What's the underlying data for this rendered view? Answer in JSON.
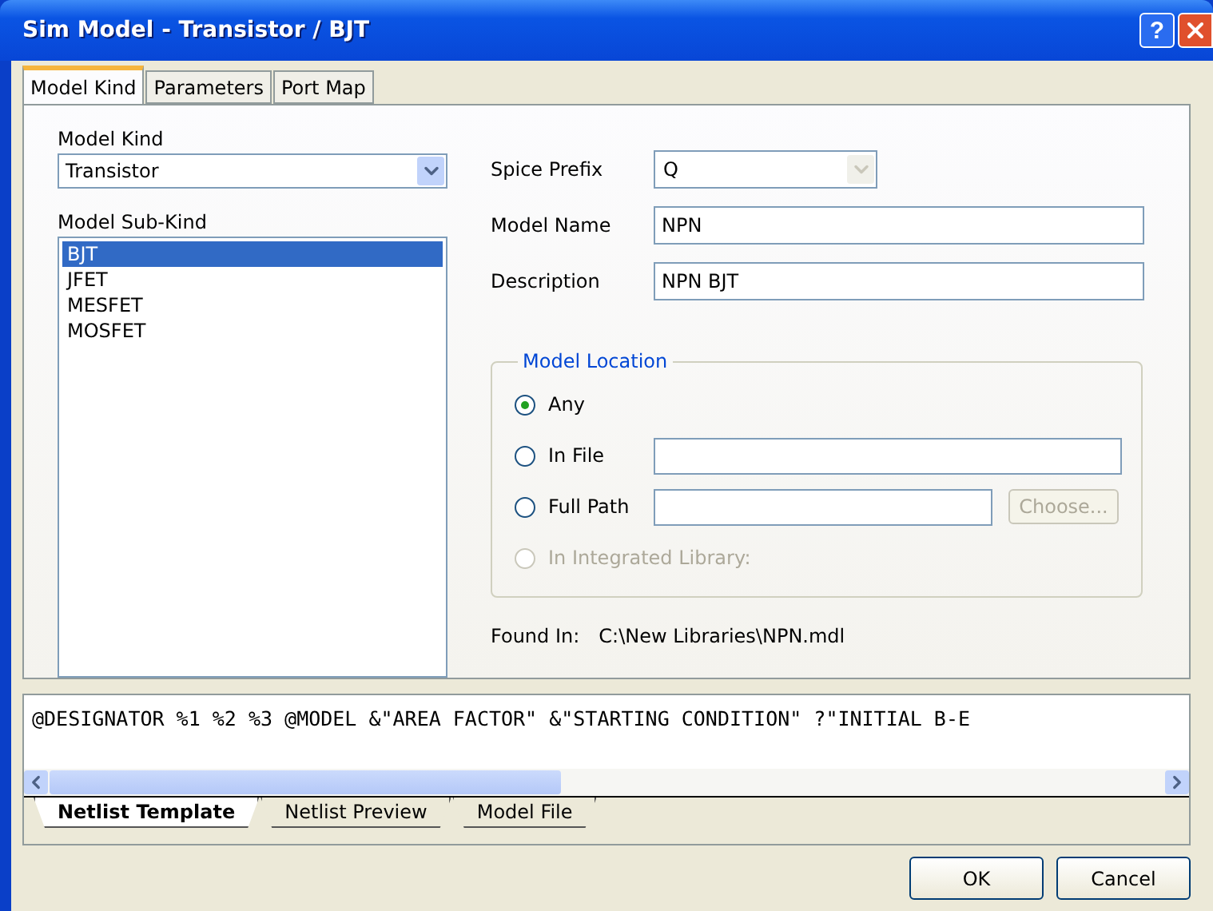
{
  "window": {
    "title": "Sim Model - Transistor / BJT",
    "help": "?"
  },
  "tabs": [
    {
      "label": "Model Kind",
      "selected": true
    },
    {
      "label": "Parameters",
      "selected": false
    },
    {
      "label": "Port Map",
      "selected": false
    }
  ],
  "model_kind": {
    "label": "Model Kind",
    "value": "Transistor"
  },
  "model_sub_kind": {
    "label": "Model Sub-Kind",
    "items": [
      {
        "label": "BJT",
        "selected": true
      },
      {
        "label": "JFET",
        "selected": false
      },
      {
        "label": "MESFET",
        "selected": false
      },
      {
        "label": "MOSFET",
        "selected": false
      }
    ]
  },
  "spice_prefix": {
    "label": "Spice Prefix",
    "value": "Q",
    "disabled": true
  },
  "model_name": {
    "label": "Model Name",
    "value": "NPN"
  },
  "description": {
    "label": "Description",
    "value": "NPN BJT"
  },
  "model_location": {
    "title": "Model Location",
    "options": [
      {
        "kind": "plain",
        "label": "Any",
        "selected": true,
        "disabled": false
      },
      {
        "kind": "field",
        "label": "In File",
        "selected": false,
        "disabled": false
      },
      {
        "kind": "path",
        "label": "Full Path",
        "selected": false,
        "disabled": false,
        "button": "Choose..."
      },
      {
        "kind": "plain",
        "label": "In Integrated Library:",
        "selected": false,
        "disabled": true
      }
    ]
  },
  "found_in": {
    "label": "Found In:",
    "value": "C:\\New Libraries\\NPN.mdl"
  },
  "netlist": {
    "text": "@DESIGNATOR %1 %2 %3 @MODEL &\"AREA FACTOR\" &\"STARTING CONDITION\" ?\"INITIAL B-E",
    "tabs": [
      {
        "label": "Netlist Template",
        "selected": true
      },
      {
        "label": "Netlist Preview",
        "selected": false
      },
      {
        "label": "Model File",
        "selected": false
      }
    ]
  },
  "buttons": [
    "OK",
    "Cancel"
  ]
}
